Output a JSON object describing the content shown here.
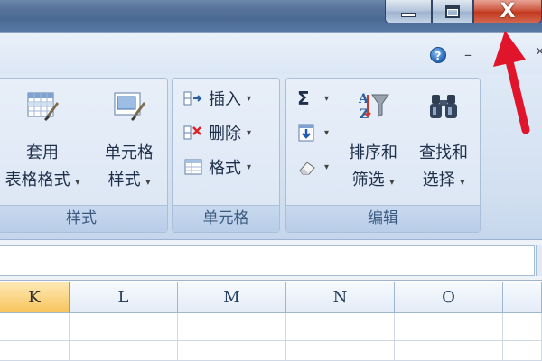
{
  "window": {
    "minimize_icon": "minimize-icon",
    "maximize_icon": "restore-icon",
    "close_label": "X"
  },
  "ribbon_top": {
    "help_label": "?",
    "minimize_label": "–",
    "close_label": "×"
  },
  "groups": {
    "styles": {
      "label": "样式",
      "table_format": {
        "line1": "套用",
        "line2": "表格格式",
        "dropdown": "▾"
      },
      "cell_style": {
        "line1": "单元格",
        "line2": "样式",
        "dropdown": "▾"
      }
    },
    "cells": {
      "label": "单元格",
      "insert": {
        "label": "插入",
        "dropdown": "▾"
      },
      "delete": {
        "label": "删除",
        "dropdown": "▾"
      },
      "format": {
        "label": "格式",
        "dropdown": "▾"
      }
    },
    "editing": {
      "label": "编辑",
      "sum_dropdown": "▾",
      "fill_dropdown": "▾",
      "clear_dropdown": "▾",
      "sort_filter": {
        "line1": "排序和",
        "line2": "筛选",
        "dropdown": "▾"
      },
      "find_select": {
        "line1": "查找和",
        "line2": "选择",
        "dropdown": "▾"
      }
    }
  },
  "columns": [
    "K",
    "L",
    "M",
    "N",
    "O"
  ],
  "selected_column": "K",
  "colors": {
    "close_red": "#c2391d",
    "selected_header": "#f8c45d",
    "annotation_arrow": "#e0142a"
  }
}
